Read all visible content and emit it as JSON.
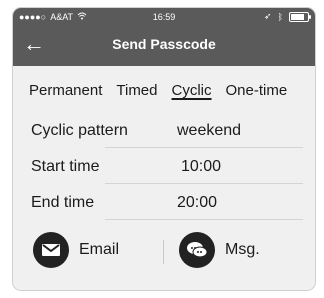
{
  "status_bar": {
    "carrier": "A&AT",
    "time": "16:59",
    "battery_level_percent": 80
  },
  "header": {
    "title": "Send Passcode",
    "back_symbol": "←"
  },
  "tabs": [
    {
      "label": "Permanent",
      "active": false
    },
    {
      "label": "Timed",
      "active": false
    },
    {
      "label": "Cyclic",
      "active": true
    },
    {
      "label": "One-time",
      "active": false
    }
  ],
  "fields": {
    "cyclic_pattern": {
      "label": "Cyclic pattern",
      "value": "weekend"
    },
    "start_time": {
      "label": "Start time",
      "value": "10:00"
    },
    "end_time": {
      "label": "End time",
      "value": "20:00"
    }
  },
  "actions": {
    "email": {
      "label": "Email",
      "icon": "mail-icon"
    },
    "msg": {
      "label": "Msg.",
      "icon": "chat-bubbles-icon"
    }
  }
}
